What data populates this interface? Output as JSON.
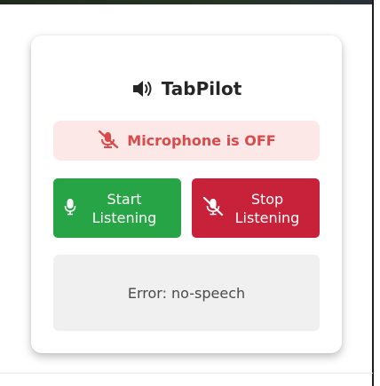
{
  "app": {
    "title": "TabPilot",
    "title_icon": "speaker-icon"
  },
  "status": {
    "text": "Microphone is OFF",
    "icon": "microphone-off-icon",
    "color": "#d94a4a",
    "background": "#fde8e8"
  },
  "buttons": {
    "start_label": "Start Listening",
    "start_icon": "microphone-icon",
    "start_color": "#26a446",
    "stop_label": "Stop Listening",
    "stop_icon": "microphone-slash-icon",
    "stop_color": "#c8223a"
  },
  "error": {
    "text": "Error: no-speech"
  }
}
